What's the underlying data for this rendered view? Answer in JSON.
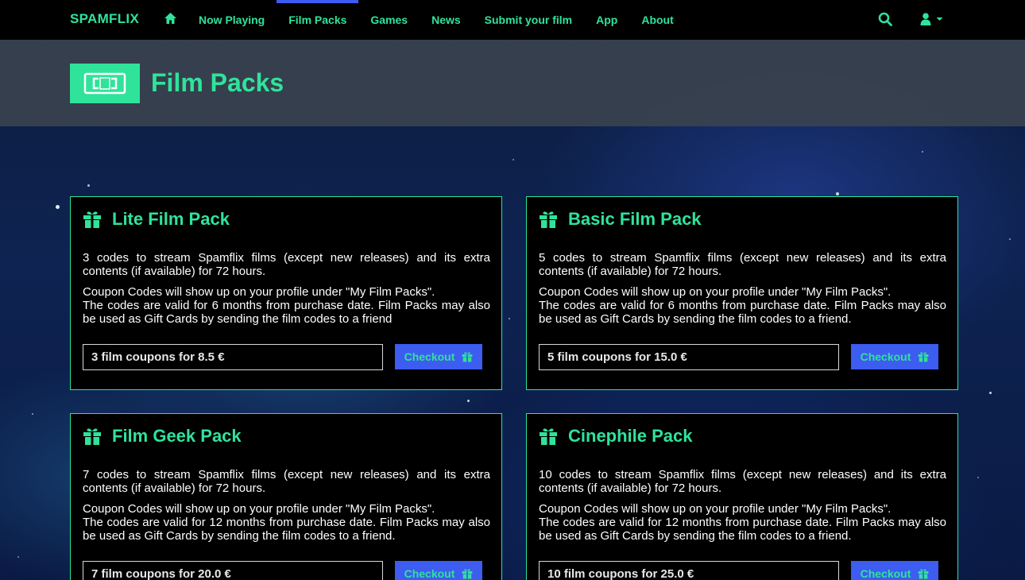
{
  "nav": {
    "brand": "SPAMFLIX",
    "items": [
      {
        "label": "Now Playing"
      },
      {
        "label": "Film Packs",
        "active": true
      },
      {
        "label": "Games"
      },
      {
        "label": "News"
      },
      {
        "label": "Submit your film"
      },
      {
        "label": "App"
      },
      {
        "label": "About"
      }
    ],
    "icons": [
      "home-icon",
      "search-icon",
      "user-icon",
      "caret-down-icon"
    ]
  },
  "header": {
    "title": "Film Packs",
    "icon": "ticket-icon"
  },
  "packs": [
    {
      "title": "Lite Film Pack",
      "description": "3 codes to stream Spamflix films (except new releases) and its extra contents (if available) for 72 hours.",
      "coupon_info": "Coupon Codes will show up on your profile under \"My Film Packs\".",
      "validity": "The codes are valid for 6 months from purchase date. Film Packs may also be used as Gift Cards by sending the film codes to a friend",
      "option": "3 film coupons for 8.5 €",
      "button": "Checkout"
    },
    {
      "title": "Basic Film Pack",
      "description": "5 codes to stream Spamflix films (except new releases) and its extra contents (if available) for 72 hours.",
      "coupon_info": "Coupon Codes will show up on your profile under \"My Film Packs\".",
      "validity": "The codes are valid for 6 months from purchase date. Film Packs may also be used as Gift Cards by sending the film codes to a friend.",
      "option": "5 film coupons for 15.0 €",
      "button": "Checkout"
    },
    {
      "title": "Film Geek Pack",
      "description": "7 codes to stream Spamflix films (except new releases) and its extra contents (if available) for 72 hours.",
      "coupon_info": "Coupon Codes will show up on your profile under \"My Film Packs\".",
      "validity": "The codes are valid for 12 months from purchase date. Film Packs may also be used as Gift Cards by sending the film codes to a friend.",
      "option": "7 film coupons for 20.0 €",
      "button": "Checkout"
    },
    {
      "title": "Cinephile Pack",
      "description": "10 codes to stream Spamflix films (except new releases) and its extra contents (if available) for 72 hours.",
      "coupon_info": "Coupon Codes will show up on your profile under \"My Film Packs\".",
      "validity": "The codes are valid for 12 months from purchase date. Film Packs may also be used as Gift Cards by sending the film codes to a friend.",
      "option": "10 film coupons for 25.0 €",
      "button": "Checkout"
    }
  ],
  "colors": {
    "accent": "#2fe39a",
    "button": "#3d5cf0",
    "navbar": "#000000",
    "header_band": "#3a424e"
  }
}
